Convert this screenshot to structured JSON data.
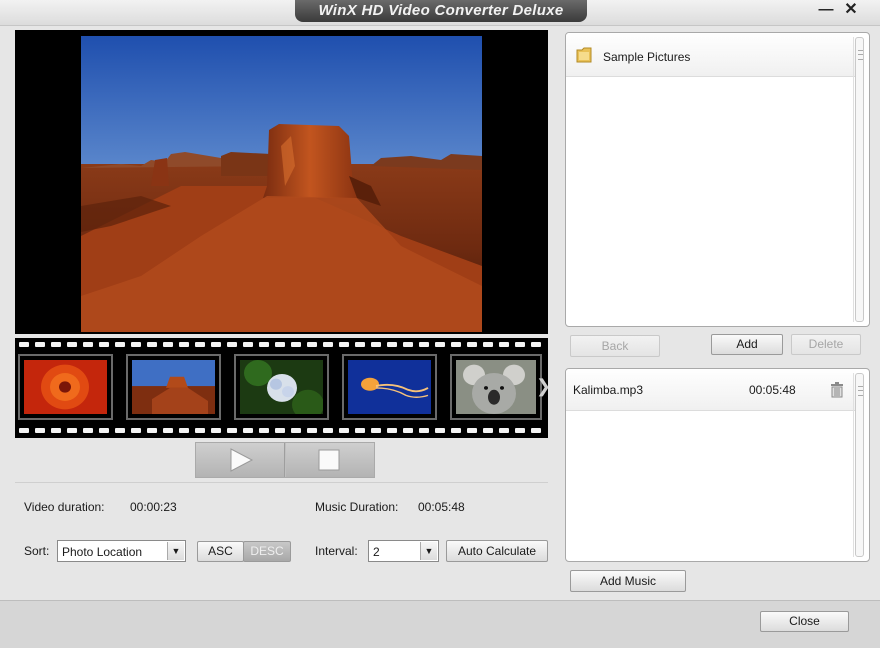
{
  "window": {
    "title": "WinX HD Video Converter Deluxe",
    "minimize_glyph": "—",
    "close_glyph": "✕"
  },
  "preview": {
    "film_next_glyph": "❯"
  },
  "info": {
    "video_duration_label": "Video duration:",
    "video_duration": "00:00:23",
    "music_duration_label": "Music Duration:",
    "music_duration": "00:05:48"
  },
  "sort": {
    "label": "Sort:",
    "value": "Photo Location",
    "asc_label": "ASC",
    "desc_label": "DESC"
  },
  "interval": {
    "label": "Interval:",
    "value": "2",
    "auto_label": "Auto Calculate"
  },
  "folders": {
    "items": [
      {
        "name": "Sample Pictures",
        "icon": "folder-icon"
      }
    ],
    "back_label": "Back",
    "add_label": "Add",
    "delete_label": "Delete"
  },
  "music": {
    "items": [
      {
        "name": "Kalimba.mp3",
        "duration": "00:05:48",
        "icon": "trash-icon"
      }
    ],
    "add_music_label": "Add Music"
  },
  "footer": {
    "close_label": "Close"
  },
  "colors": {
    "titlebar_tab": "#4a4a4a",
    "preview_bg": "#000000",
    "panel_border": "#a9a9a9"
  }
}
